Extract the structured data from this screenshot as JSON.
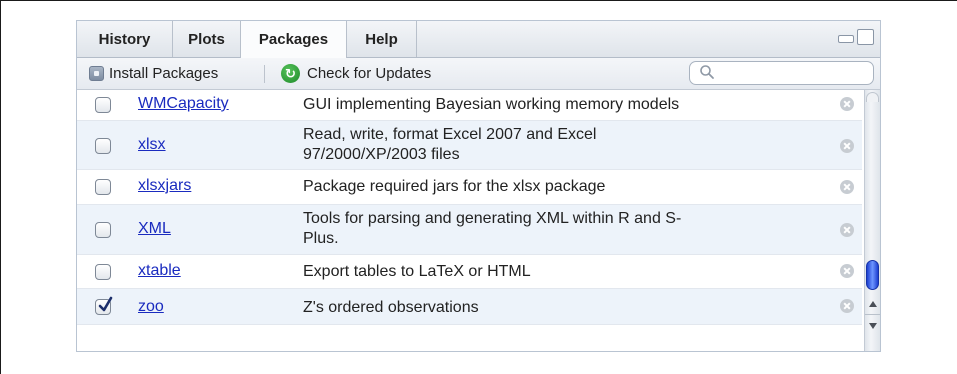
{
  "tabs": [
    {
      "label": "History",
      "active": false
    },
    {
      "label": "Plots",
      "active": false
    },
    {
      "label": "Packages",
      "active": true
    },
    {
      "label": "Help",
      "active": false
    }
  ],
  "toolbar": {
    "install_label": "Install Packages",
    "check_updates_label": "Check for Updates",
    "search_placeholder": ""
  },
  "packages": [
    {
      "name": "WMCapacity",
      "description": "GUI implementing Bayesian working memory models",
      "checked": false
    },
    {
      "name": "xlsx",
      "description": "Read, write, format Excel 2007 and Excel",
      "description_2": "97/2000/XP/2003 files",
      "checked": false
    },
    {
      "name": "xlsxjars",
      "description": "Package required jars for the xlsx package",
      "checked": false
    },
    {
      "name": "XML",
      "description": "Tools for parsing and generating XML within R and S-",
      "description_2": "Plus.",
      "checked": false
    },
    {
      "name": "xtable",
      "description": "Export tables to LaTeX or HTML",
      "checked": false
    },
    {
      "name": "zoo",
      "description": "Z's ordered observations",
      "checked": true
    }
  ],
  "colors": {
    "link": "#1a2bbf",
    "alt_row": "#edf3fa",
    "scroll_thumb": "#3a63f0",
    "update_icon": "#2fa23a"
  }
}
